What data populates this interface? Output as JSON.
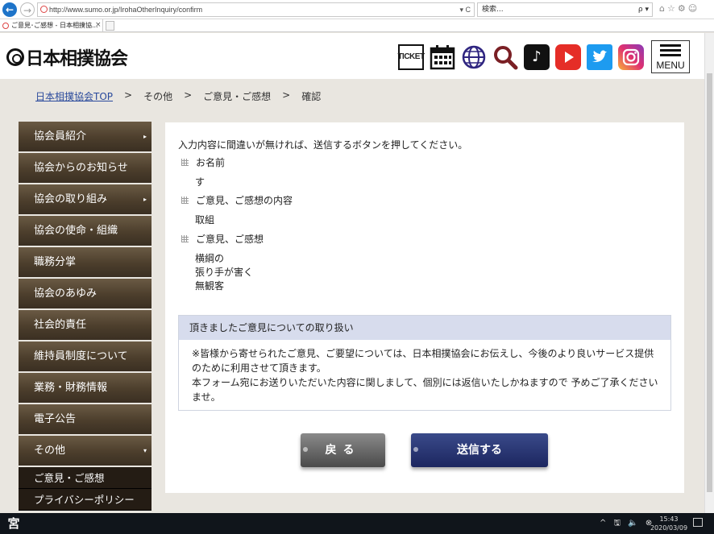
{
  "browser": {
    "url": "http://www.sumo.or.jp/IrohaOtherInquiry/confirm",
    "url_controls": "▾ C",
    "search_placeholder": "検索...",
    "search_controls": "ρ ▾",
    "toolbar_icons": "⌂☆⚙☺",
    "tab_title": "ご意見･ご感想 - 日本相撲協...",
    "tab_close": "×"
  },
  "header": {
    "logo_text": "日本相撲協会",
    "ticket_label": "TICKET",
    "menu_label": "MENU"
  },
  "breadcrumb": {
    "home": "日本相撲協会TOP",
    "sep": ">",
    "level1": "その他",
    "level2": "ご意見・ご感想",
    "current": "確認"
  },
  "sidebar": {
    "items": [
      {
        "label": "協会員紹介",
        "caret": "▸"
      },
      {
        "label": "協会からのお知らせ",
        "caret": ""
      },
      {
        "label": "協会の取り組み",
        "caret": "▸"
      },
      {
        "label": "協会の使命・組織",
        "caret": ""
      },
      {
        "label": "職務分掌",
        "caret": ""
      },
      {
        "label": "協会のあゆみ",
        "caret": ""
      },
      {
        "label": "社会的責任",
        "caret": ""
      },
      {
        "label": "維持員制度について",
        "caret": ""
      },
      {
        "label": "業務・財務情報",
        "caret": ""
      },
      {
        "label": "電子公告",
        "caret": ""
      },
      {
        "label": "その他",
        "caret": "▾"
      }
    ],
    "sub_items": [
      "ご意見・ご感想",
      "プライバシーポリシー"
    ]
  },
  "form": {
    "intro": "入力内容に間違いが無ければ、送信するボタンを押してください。",
    "fields": [
      {
        "label": "お名前",
        "value": "す"
      },
      {
        "label": "ご意見、ご感想の内容",
        "value": "取組"
      },
      {
        "label": "ご意見、ご感想",
        "value_lines": [
          "横綱の",
          "張り手が害く",
          "無観客"
        ]
      }
    ],
    "notice_title": "頂きましたご意見についての取り扱い",
    "notice_lines": [
      "※皆様から寄せられたご意見、ご要望については、日本相撲協会にお伝えし、今後のより良いサービス提供",
      "のために利用させて頂きます。",
      "本フォーム宛にお送りいただいた内容に関しまして、個別には返信いたしかねますので 予めご了承くださ",
      "い",
      "ませ。"
    ],
    "back_button": "戻る",
    "submit_button": "送信する"
  },
  "taskbar": {
    "app_icon": "宮",
    "tray": "^ 🖫 🔈 ⊗",
    "time": "15:43",
    "date": "2020/03/09"
  }
}
